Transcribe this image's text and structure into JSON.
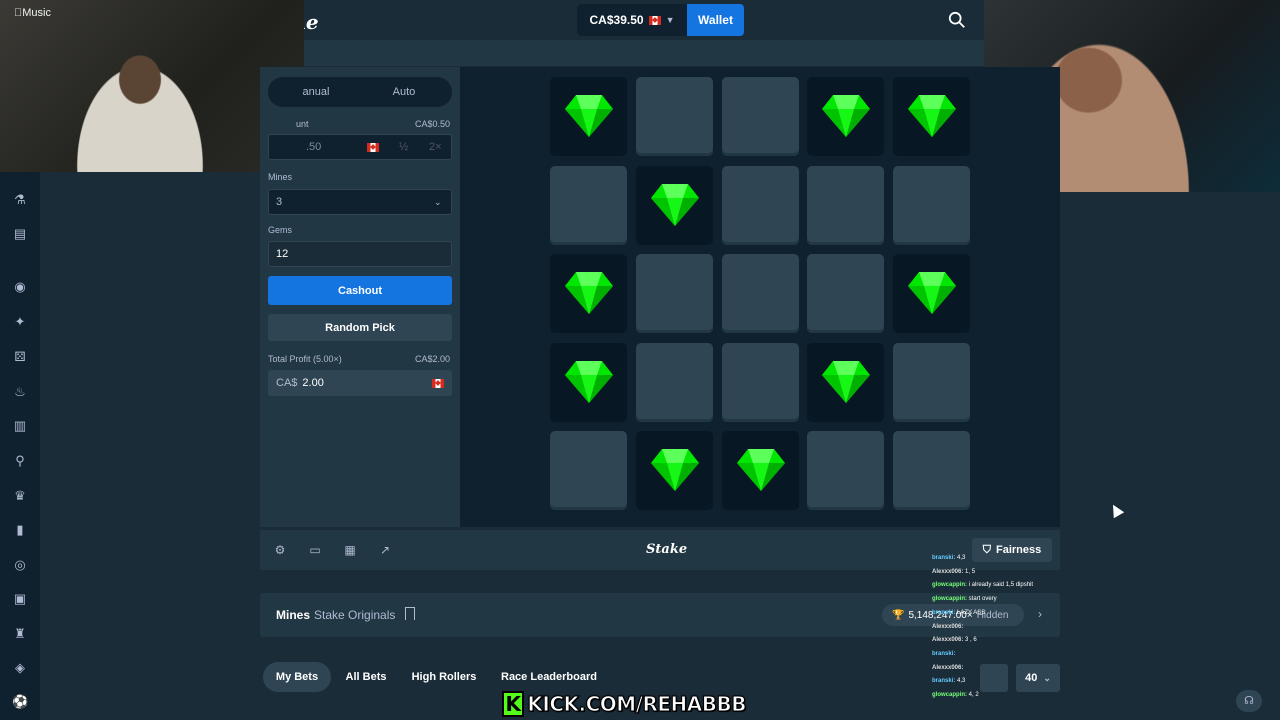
{
  "header": {
    "brand": "ke",
    "balance": "CA$39.50",
    "wallet_label": "Wallet"
  },
  "overlay": {
    "music_logo": "Music",
    "kick_url": "KICK.COM/REHABBB",
    "kick_logo": "K"
  },
  "panel": {
    "tabs": [
      "anual",
      "Auto"
    ],
    "bet_amount_label": "unt",
    "bet_amount_value": "CA$0.50",
    "bet_input": ".50",
    "half_label": "½",
    "double_label": "2×",
    "mines_label": "Mines",
    "mines_value": "3",
    "gems_label": "Gems",
    "gems_value": "12",
    "cashout_label": "Cashout",
    "random_pick_label": "Random Pick",
    "profit_label": "Total Profit (5.00×)",
    "profit_value": "CA$2.00",
    "profit_currency": "CA$",
    "profit_input": "2.00"
  },
  "board": {
    "tiles": [
      "gem",
      "hidden",
      "hidden",
      "gem",
      "gem",
      "hidden",
      "gem",
      "hidden",
      "hidden",
      "hidden",
      "gem",
      "hidden",
      "hidden",
      "hidden",
      "gem",
      "gem",
      "hidden",
      "hidden",
      "gem",
      "hidden",
      "hidden",
      "gem",
      "gem",
      "hidden",
      "hidden"
    ],
    "gem_color": "#00e701"
  },
  "toolbar": {
    "brand": "Stake",
    "fairness_label": "Fairness"
  },
  "info": {
    "game_title": "Mines",
    "game_sub": "Stake Originals",
    "stat_value": "5,148,247.00×",
    "stat_user": "Hidden"
  },
  "bets": {
    "tabs": [
      "My Bets",
      "All Bets",
      "High Rollers",
      "Race Leaderboard"
    ],
    "rows_value": "40"
  },
  "chat": [
    {
      "user": "branski",
      "msg": "4,3",
      "color": "#6cf"
    },
    {
      "user": "Alexxx006",
      "msg": "1, 5",
      "color": "#ddd"
    },
    {
      "user": "glowcappin",
      "msg": "i already said 1,5 dipshit",
      "color": "#7f7"
    },
    {
      "user": "glowcappin",
      "msg": "start overy",
      "color": "#7f7"
    },
    {
      "user": "branski",
      "msg": "LAZY ASS",
      "color": "#6cf"
    },
    {
      "user": "Alexxx006",
      "msg": "",
      "color": "#ddd"
    },
    {
      "user": "Alexxx006",
      "msg": "3 , 6",
      "color": "#ddd"
    },
    {
      "user": "branski",
      "msg": "",
      "color": "#6cf"
    },
    {
      "user": "Alexxx006",
      "msg": "",
      "color": "#ddd"
    },
    {
      "user": "branski",
      "msg": "4,3",
      "color": "#6cf"
    },
    {
      "user": "glowcappin",
      "msg": "4, 2",
      "color": "#7f7"
    }
  ]
}
